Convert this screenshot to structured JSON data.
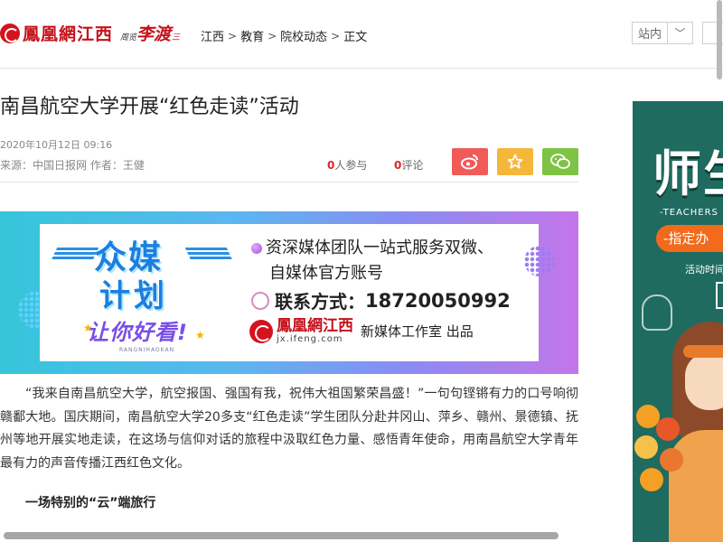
{
  "header": {
    "logo_text": "鳳凰網江西",
    "partner_logo_prefix": "周览",
    "partner_logo_main": "李渡",
    "partner_logo_suffix": "三",
    "breadcrumbs": [
      "江西",
      "教育",
      "院校动态",
      "正文"
    ],
    "breadcrumb_separator": ">",
    "site_select_label": "站内",
    "site_select_chevron": "﹀"
  },
  "article": {
    "title": "南昌航空大学开展“红色走读”活动",
    "date": "2020年10月12日  09:16",
    "source": "来源：中国日报网  作者：王健",
    "participants_count": "0",
    "participants_label": "人参与",
    "comments_count": "0",
    "comments_label": "评论",
    "share_buttons": [
      {
        "name": "weibo-share",
        "icon": "weibo-icon",
        "color": "#f05a57"
      },
      {
        "name": "qzone-share",
        "icon": "star-icon",
        "color": "#f5b73a"
      },
      {
        "name": "wechat-share",
        "icon": "wechat-icon",
        "color": "#7fc344"
      }
    ],
    "paragraph_1": "“我来自南昌航空大学，航空报国、强国有我，祝伟大祖国繁荣昌盛！”一句句铿锵有力的口号响彻赣鄱大地。国庆期间，南昌航空大学20多支“红色走读”学生团队分赴井冈山、萍乡、赣州、景德镇、抚州等地开展实地走读，在这场与信仰对话的旅程中汲取红色力量、感悟青年使命，用南昌航空大学青年最有力的声音传播江西红色文化。",
    "subheading": "一场特别的“云”端旅行",
    "paragraph_2_partial": "……"
  },
  "banner": {
    "title_line1": "众媒",
    "title_line2": "计划",
    "slogan": "让你好看!",
    "slogan_pinyin": "RANGNIHAOKAN",
    "service_line1": "资深媒体团队一站式服务双微、",
    "service_line2": "自媒体官方账号",
    "contact_label": "联系方式：",
    "contact_number": "18720050992",
    "brand_name": "鳳凰網江西",
    "brand_url": "jx.ifeng.com",
    "studio_text": "新媒体工作室 出品"
  },
  "side_ad": {
    "headline": "师生",
    "english_text": "-TEACHERS",
    "pill_text": "-指定办",
    "time_text": "活动时间"
  },
  "colors": {
    "brand_red": "#c4121b",
    "accent_red": "#e0232c",
    "side_ad_bg": "#1f6b5f",
    "pill_orange": "#f26a1b"
  }
}
